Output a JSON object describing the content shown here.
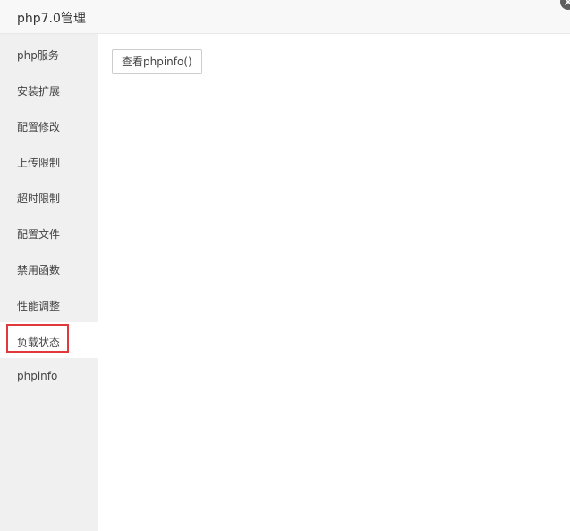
{
  "window": {
    "title": "php7.0管理"
  },
  "sidebar": {
    "items": [
      {
        "label": "php服务"
      },
      {
        "label": "安装扩展"
      },
      {
        "label": "配置修改"
      },
      {
        "label": "上传限制"
      },
      {
        "label": "超时限制"
      },
      {
        "label": "配置文件"
      },
      {
        "label": "禁用函数"
      },
      {
        "label": "性能调整"
      },
      {
        "label": "负载状态"
      },
      {
        "label": "phpinfo"
      }
    ],
    "active_index": 8
  },
  "main": {
    "view_phpinfo_label": "查看phpinfo()"
  },
  "colors": {
    "highlight": "#e0393b",
    "sidebar_bg": "#f0f0f0",
    "titlebar_bg": "#f8f8f8"
  }
}
